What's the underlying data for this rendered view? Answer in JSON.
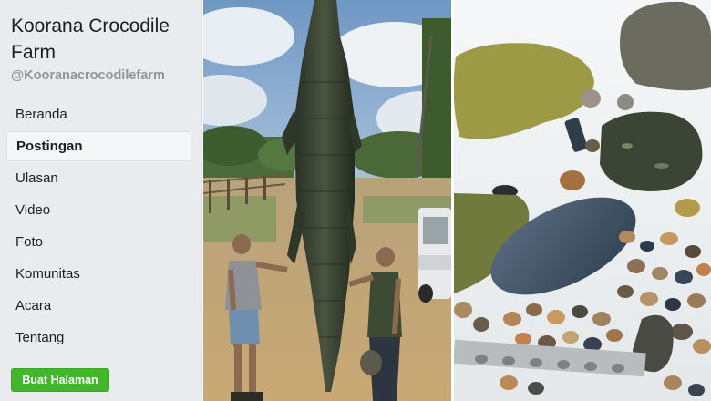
{
  "sidebar": {
    "page_name": "Koorana Crocodile Farm",
    "page_handle": "@Kooranacrocodilefarm",
    "nav_items": [
      {
        "label": "Beranda",
        "active": false
      },
      {
        "label": "Postingan",
        "active": true
      },
      {
        "label": "Ulasan",
        "active": false
      },
      {
        "label": "Video",
        "active": false
      },
      {
        "label": "Foto",
        "active": false
      },
      {
        "label": "Komunitas",
        "active": false
      },
      {
        "label": "Acara",
        "active": false
      },
      {
        "label": "Tentang",
        "active": false
      }
    ],
    "create_page_label": "Buat Halaman"
  },
  "colors": {
    "sidebar_bg": "#e9ebee",
    "accent_green": "#42b72a",
    "text_primary": "#1c1e21",
    "text_secondary": "#90949c"
  }
}
